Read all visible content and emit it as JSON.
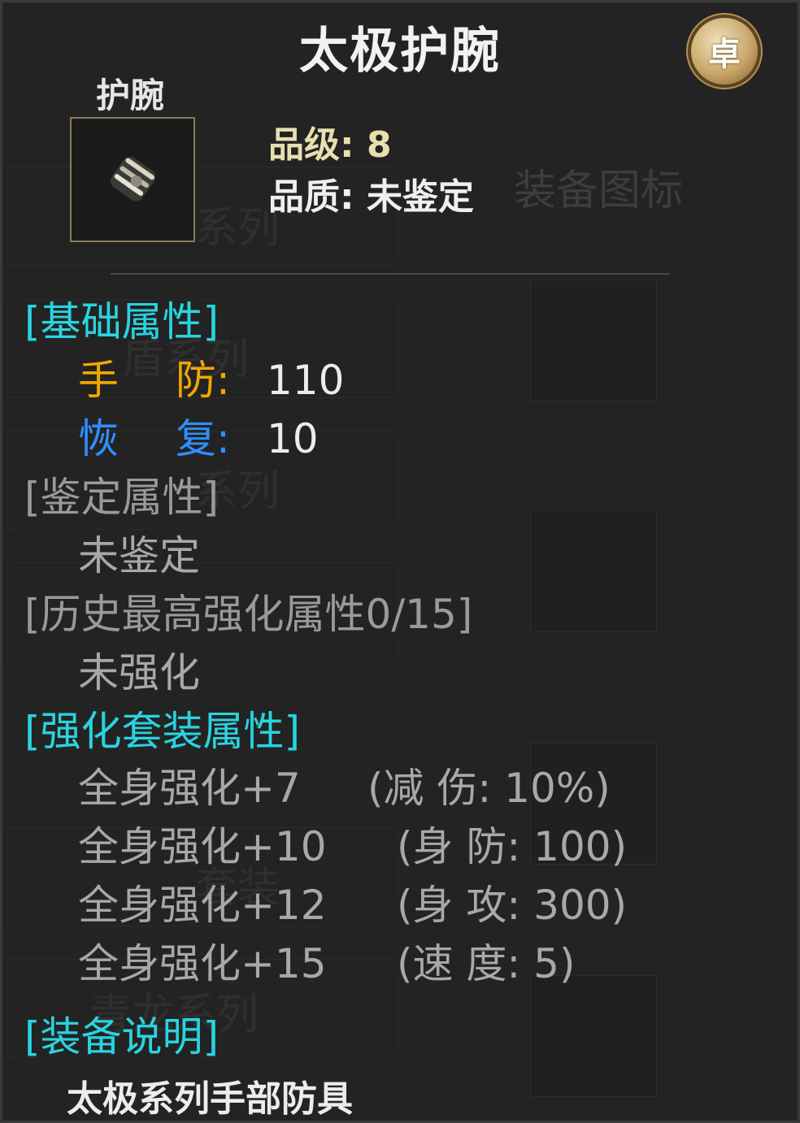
{
  "tooltip": {
    "title": "太极护腕",
    "badge_char": "卓",
    "slot_label": "护腕",
    "grade_label": "品级:",
    "grade_value": "8",
    "quality_label": "品质:",
    "quality_value": "未鉴定"
  },
  "background": {
    "header": "装备图标",
    "series_labels": [
      "系列",
      "盾系列",
      "系列",
      "套装",
      "青龙系列"
    ]
  },
  "base_attrs": {
    "header": "[基础属性]",
    "items": [
      {
        "k1": "手",
        "k2": "防:",
        "value": "110"
      },
      {
        "k1": "恢",
        "k2": "复:",
        "value": "10"
      }
    ]
  },
  "identify": {
    "header": "[鉴定属性]",
    "value": "未鉴定"
  },
  "history": {
    "header": "[历史最高强化属性0/15]",
    "value": "未强化"
  },
  "set_bonus": {
    "header": "[强化套装属性]",
    "items": [
      {
        "req": "全身强化+7",
        "bonus": "(减 伤: 10%)"
      },
      {
        "req": "全身强化+10",
        "bonus": "(身 防: 100)"
      },
      {
        "req": "全身强化+12",
        "bonus": "(身 攻: 300)"
      },
      {
        "req": "全身强化+15",
        "bonus": "(速 度: 5)"
      }
    ]
  },
  "description": {
    "header": "[装备说明]",
    "text": "太极系列手部防具"
  },
  "colors": {
    "section": "#29d4e0",
    "attr_defense": "#f0a800",
    "attr_recover": "#2f8fff",
    "grade": "#e8dfae"
  }
}
